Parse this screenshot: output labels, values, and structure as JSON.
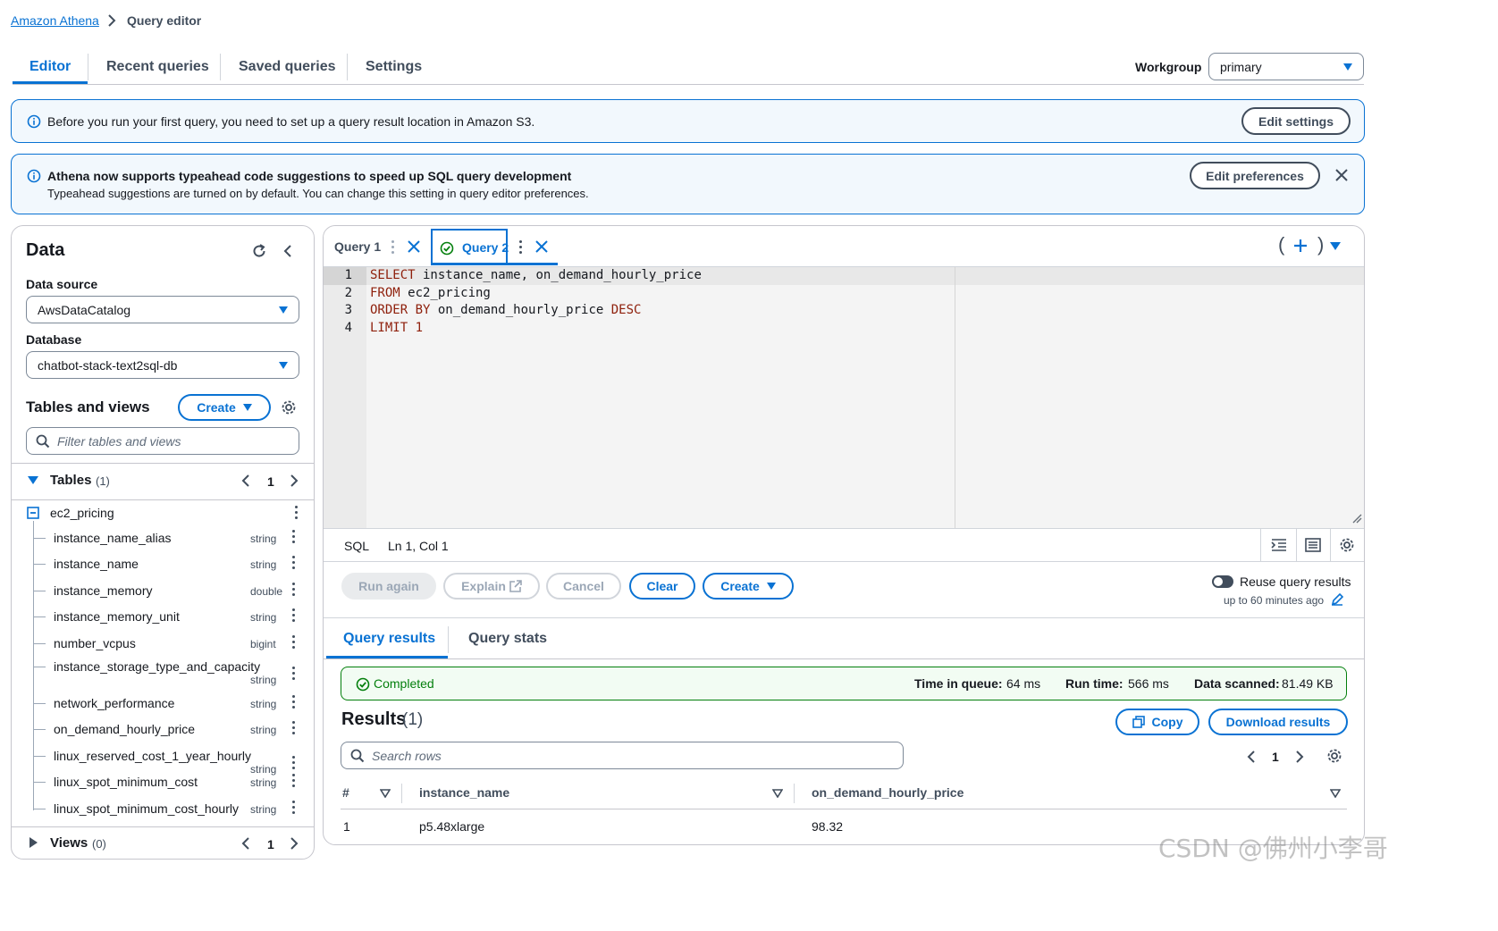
{
  "breadcrumb": {
    "root": "Amazon Athena",
    "current": "Query editor"
  },
  "tabs": [
    "Editor",
    "Recent queries",
    "Saved queries",
    "Settings"
  ],
  "workgroup": {
    "label": "Workgroup",
    "value": "primary"
  },
  "banner1": {
    "text": "Before you run your first query, you need to set up a query result location in Amazon S3.",
    "button": "Edit settings"
  },
  "banner2": {
    "title": "Athena now supports typeahead code suggestions to speed up SQL query development",
    "text": "Typeahead suggestions are turned on by default. You can change this setting in query editor preferences.",
    "button": "Edit preferences"
  },
  "data_panel": {
    "title": "Data",
    "data_source_label": "Data source",
    "data_source_value": "AwsDataCatalog",
    "database_label": "Database",
    "database_value": "chatbot-stack-text2sql-db",
    "tables_views_title": "Tables and views",
    "create_label": "Create",
    "filter_placeholder": "Filter tables and views",
    "tables_label": "Tables",
    "tables_count": "(1)",
    "tables_page": "1",
    "table_name": "ec2_pricing",
    "columns": [
      {
        "name": "instance_name_alias",
        "type": "string"
      },
      {
        "name": "instance_name",
        "type": "string"
      },
      {
        "name": "instance_memory",
        "type": "double"
      },
      {
        "name": "instance_memory_unit",
        "type": "string"
      },
      {
        "name": "number_vcpus",
        "type": "bigint"
      },
      {
        "name": "instance_storage_type_and_capacity",
        "type": "string"
      },
      {
        "name": "network_performance",
        "type": "string"
      },
      {
        "name": "on_demand_hourly_price",
        "type": "string"
      },
      {
        "name": "linux_reserved_cost_1_year_hourly",
        "type": "string"
      },
      {
        "name": "linux_spot_minimum_cost",
        "type": "string"
      },
      {
        "name": "linux_spot_minimum_cost_hourly",
        "type": "string"
      }
    ],
    "views_label": "Views",
    "views_count": "(0)",
    "views_page": "1"
  },
  "editor": {
    "query_tabs": [
      "Query 1",
      "Query 2"
    ],
    "lines": [
      {
        "num": "1",
        "parts": [
          [
            "kw",
            "SELECT"
          ],
          [
            "tx",
            " instance_name, on_demand_hourly_price"
          ]
        ]
      },
      {
        "num": "2",
        "parts": [
          [
            "kw",
            "FROM"
          ],
          [
            "tx",
            " ec2_pricing"
          ]
        ]
      },
      {
        "num": "3",
        "parts": [
          [
            "kw",
            "ORDER BY"
          ],
          [
            "tx",
            " on_demand_hourly_price "
          ],
          [
            "kw",
            "DESC"
          ]
        ]
      },
      {
        "num": "4",
        "parts": [
          [
            "kw",
            "LIMIT"
          ],
          [
            "kw",
            " 1"
          ]
        ]
      }
    ],
    "status_lang": "SQL",
    "status_pos": "Ln 1, Col 1"
  },
  "actions": {
    "run_again": "Run again",
    "explain": "Explain",
    "cancel": "Cancel",
    "clear": "Clear",
    "create": "Create",
    "reuse_label": "Reuse query results",
    "reuse_sub": "up to 60 minutes ago"
  },
  "results": {
    "tabs": [
      "Query results",
      "Query stats"
    ],
    "status": "Completed",
    "time_in_queue_label": "Time in queue:",
    "time_in_queue": "64 ms",
    "run_time_label": "Run time:",
    "run_time": "566 ms",
    "data_scanned_label": "Data scanned:",
    "data_scanned": "81.49 KB",
    "title": "Results",
    "count": "(1)",
    "copy": "Copy",
    "download": "Download results",
    "search_placeholder": "Search rows",
    "page": "1",
    "columns": [
      "#",
      "instance_name",
      "on_demand_hourly_price"
    ],
    "rows": [
      [
        "1",
        "p5.48xlarge",
        "98.32"
      ]
    ]
  },
  "watermark": "CSDN @佛州小李哥",
  "colors": {
    "accent": "#0972d3",
    "success": "#037f0c",
    "keyword": "#8e1f0b"
  }
}
